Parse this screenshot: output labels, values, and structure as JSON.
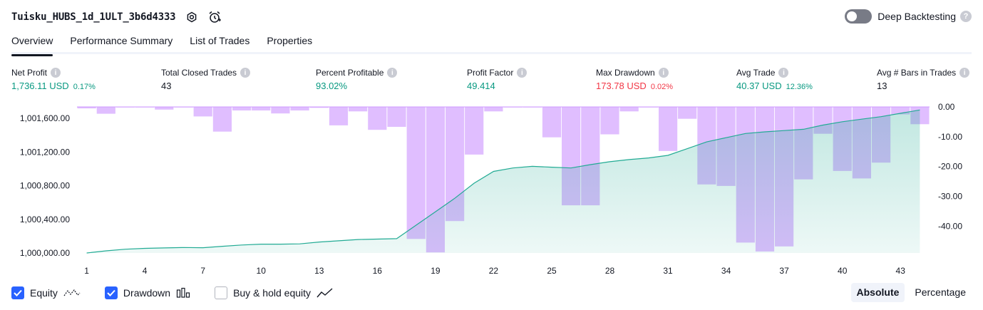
{
  "header": {
    "title": "Tuisku_HUBS_1d_1ULT_3b6d4333",
    "deep_backtesting_label": "Deep Backtesting"
  },
  "tabs": [
    {
      "label": "Overview",
      "active": true
    },
    {
      "label": "Performance Summary",
      "active": false
    },
    {
      "label": "List of Trades",
      "active": false
    },
    {
      "label": "Properties",
      "active": false
    }
  ],
  "metrics": {
    "net_profit": {
      "label": "Net Profit",
      "value": "1,736.11 USD",
      "sub": "0.17%"
    },
    "total_closed_trades": {
      "label": "Total Closed Trades",
      "value": "43"
    },
    "percent_profitable": {
      "label": "Percent Profitable",
      "value": "93.02%"
    },
    "profit_factor": {
      "label": "Profit Factor",
      "value": "49.414"
    },
    "max_drawdown": {
      "label": "Max Drawdown",
      "value": "173.78 USD",
      "sub": "0.02%"
    },
    "avg_trade": {
      "label": "Avg Trade",
      "value": "40.37 USD",
      "sub": "12.36%"
    },
    "avg_bars": {
      "label": "Avg # Bars in Trades",
      "value": "13"
    }
  },
  "chart_data": {
    "type": "area",
    "x": [
      1,
      2,
      3,
      4,
      5,
      6,
      7,
      8,
      9,
      10,
      11,
      12,
      13,
      14,
      15,
      16,
      17,
      18,
      19,
      20,
      21,
      22,
      23,
      24,
      25,
      26,
      27,
      28,
      29,
      30,
      31,
      32,
      33,
      34,
      35,
      36,
      37,
      38,
      39,
      40,
      41,
      42,
      43,
      44
    ],
    "xticks": [
      "1",
      "4",
      "7",
      "10",
      "13",
      "16",
      "19",
      "22",
      "25",
      "28",
      "31",
      "34",
      "37",
      "40",
      "43"
    ],
    "left_ticks": [
      "1,001,600.00",
      "1,001,200.00",
      "1,000,800.00",
      "1,000,400.00",
      "1,000,000.00"
    ],
    "right_ticks": [
      "0.00",
      "-10.00",
      "-20.00",
      "-30.00",
      "-40.00"
    ],
    "left_ylim": [
      1000000,
      1001736
    ],
    "right_ylim": [
      -49,
      0
    ],
    "series": [
      {
        "name": "Equity",
        "color": "#22ab94",
        "values": [
          1000000,
          1000025,
          1000045,
          1000055,
          1000060,
          1000065,
          1000063,
          1000080,
          1000095,
          1000105,
          1000105,
          1000108,
          1000130,
          1000145,
          1000160,
          1000165,
          1000170,
          1000330,
          1000490,
          1000650,
          1000830,
          1000970,
          1001010,
          1001030,
          1001020,
          1001010,
          1001050,
          1001085,
          1001110,
          1001130,
          1001160,
          1001240,
          1001320,
          1001370,
          1001420,
          1001440,
          1001455,
          1001470,
          1001520,
          1001560,
          1001590,
          1001620,
          1001660,
          1001700
        ]
      },
      {
        "name": "Drawdown",
        "color": "#cf9bff",
        "values": [
          -0.5,
          -2.3,
          -0.2,
          -0.2,
          -0.9,
          -0.2,
          -3.2,
          -8.3,
          -1.2,
          -1.2,
          -2.2,
          -1.2,
          -0.3,
          -6.2,
          -1.5,
          -7.7,
          -6.7,
          -44.3,
          -48.8,
          -38.3,
          -16.0,
          -1.5,
          -0.2,
          -0.2,
          -10.2,
          -33.0,
          -33.0,
          -9.2,
          -1.5,
          -0.2,
          -14.8,
          -4.0,
          -26.0,
          -26.5,
          -45.5,
          -48.5,
          -46.8,
          -24.3,
          -9.0,
          -21.5,
          -24.0,
          -18.7,
          -2.5,
          -5.8
        ]
      }
    ],
    "grid": false
  },
  "legend": {
    "equity": {
      "label": "Equity",
      "checked": true
    },
    "drawdown": {
      "label": "Drawdown",
      "checked": true
    },
    "buy_hold": {
      "label": "Buy & hold equity",
      "checked": false
    }
  },
  "mode": {
    "absolute": "Absolute",
    "percentage": "Percentage",
    "active": "absolute"
  },
  "colors": {
    "accent": "#2962ff",
    "profit": "#089981",
    "loss": "#f23645",
    "equity_line": "#22ab94",
    "drawdown_bar": "#cf9bff"
  },
  "icons": [
    "gear-icon",
    "alarm-clock-icon",
    "help-icon",
    "info-icon",
    "checkbox-icon",
    "equity-glyph-icon",
    "drawdown-glyph-icon",
    "buy-hold-glyph-icon"
  ]
}
